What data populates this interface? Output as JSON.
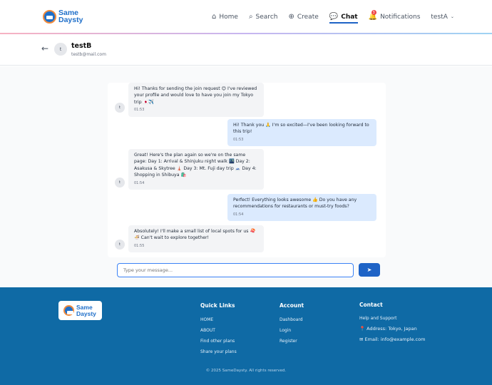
{
  "header": {
    "logo_line1": "Same",
    "logo_line2": "Daysty",
    "nav": [
      {
        "label": "Home",
        "icon": "home-icon"
      },
      {
        "label": "Search",
        "icon": "search-icon"
      },
      {
        "label": "Create",
        "icon": "plus-circle-icon"
      },
      {
        "label": "Chat",
        "icon": "chat-icon",
        "active": true
      },
      {
        "label": "Notifications",
        "icon": "bell-icon",
        "badge": "3"
      }
    ],
    "user_menu": "testA"
  },
  "chat_header": {
    "peer_initial": "t",
    "peer_name": "testB",
    "peer_email": "testb@mail.com"
  },
  "messages": [
    {
      "direction": "in",
      "text": "Hi! Thanks for sending the join request 😊 I've reviewed your profile and would love to have you join my Tokyo trip 🇯🇵✈️",
      "time": "01:53",
      "avatar": "t"
    },
    {
      "direction": "out",
      "text": "Hi! Thank you 🙏 I'm so excited—I've been looking forward to this trip!",
      "time": "01:53"
    },
    {
      "direction": "in",
      "text": "Great! Here's the plan again so we're on the same page: Day 1: Arrival & Shinjuku night walk 🌃 Day 2: Asakusa & Skytree 🗼 Day 3: Mt. Fuji day trip 🗻 Day 4: Shopping in Shibuya 🛍️",
      "time": "01:54",
      "avatar": "t"
    },
    {
      "direction": "out",
      "text": "Perfect! Everything looks awesome 👍 Do you have any recommendations for restaurants or must-try foods?",
      "time": "01:54"
    },
    {
      "direction": "in",
      "text": "Absolutely! I'll make a small list of local spots for us 🍣🍜 Can't wait to explore together!",
      "time": "01:55",
      "avatar": "t"
    }
  ],
  "composer": {
    "placeholder": "Type your message...",
    "send_icon": "paper-plane-icon"
  },
  "footer": {
    "logo_line1": "Same",
    "logo_line2": "Daysty",
    "quick_links_title": "Quick Links",
    "quick_links": [
      "HOME",
      "ABOUT",
      "Find other plans",
      "Share your plans"
    ],
    "account_title": "Account",
    "account_links": [
      "Dashboard",
      "Login",
      "Register"
    ],
    "contact_title": "Contact",
    "contact_help": "Help and Support",
    "contact_address": "Address: Tokyo, Japan",
    "contact_email": "Email: info@example.com",
    "copyright": "© 2025 SameDaysty. All rights reserved."
  },
  "colors": {
    "primary": "#1e63c6",
    "footer_bg": "#0f6aa5",
    "bubble_in": "#f3f4f6",
    "bubble_out": "#dbeafe",
    "badge": "#ef4444"
  }
}
